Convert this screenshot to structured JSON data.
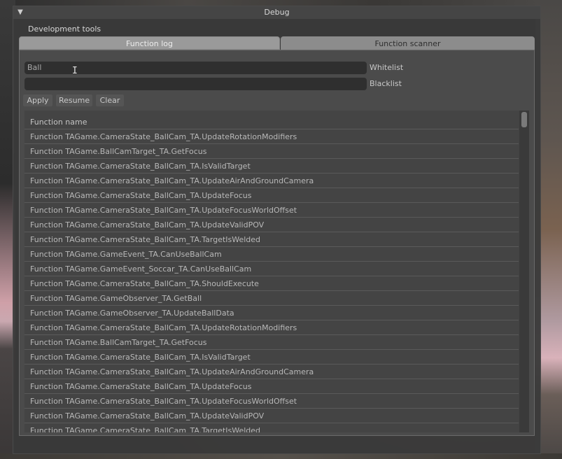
{
  "window": {
    "title": "Debug"
  },
  "section_label": "Development tools",
  "tabs": [
    {
      "label": "Function log",
      "active": true
    },
    {
      "label": "Function scanner",
      "active": false
    }
  ],
  "whitelist": {
    "value": "Ball",
    "label": "Whitelist"
  },
  "blacklist": {
    "value": "",
    "label": "Blacklist"
  },
  "buttons": {
    "apply": "Apply",
    "resume": "Resume",
    "clear": "Clear"
  },
  "list": {
    "header": "Function name",
    "rows": [
      "Function TAGame.CameraState_BallCam_TA.UpdateRotationModifiers",
      "Function TAGame.BallCamTarget_TA.GetFocus",
      "Function TAGame.CameraState_BallCam_TA.IsValidTarget",
      "Function TAGame.CameraState_BallCam_TA.UpdateAirAndGroundCamera",
      "Function TAGame.CameraState_BallCam_TA.UpdateFocus",
      "Function TAGame.CameraState_BallCam_TA.UpdateFocusWorldOffset",
      "Function TAGame.CameraState_BallCam_TA.UpdateValidPOV",
      "Function TAGame.CameraState_BallCam_TA.TargetIsWelded",
      "Function TAGame.GameEvent_TA.CanUseBallCam",
      "Function TAGame.GameEvent_Soccar_TA.CanUseBallCam",
      "Function TAGame.CameraState_BallCam_TA.ShouldExecute",
      "Function TAGame.GameObserver_TA.GetBall",
      "Function TAGame.GameObserver_TA.UpdateBallData",
      "Function TAGame.CameraState_BallCam_TA.UpdateRotationModifiers",
      "Function TAGame.BallCamTarget_TA.GetFocus",
      "Function TAGame.CameraState_BallCam_TA.IsValidTarget",
      "Function TAGame.CameraState_BallCam_TA.UpdateAirAndGroundCamera",
      "Function TAGame.CameraState_BallCam_TA.UpdateFocus",
      "Function TAGame.CameraState_BallCam_TA.UpdateFocusWorldOffset",
      "Function TAGame.CameraState_BallCam_TA.UpdateValidPOV",
      "Function TAGame.CameraState_BallCam_TA.TargetIsWelded"
    ]
  },
  "icons": {
    "collapse": "collapse-triangle-icon",
    "cursor": "text-cursor-icon"
  },
  "colors": {
    "window_bg": "#3a3a3a",
    "tab_active": "#9a9a9a",
    "input_bg": "#2f2f2f"
  }
}
